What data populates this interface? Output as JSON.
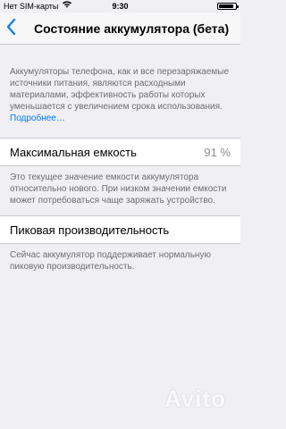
{
  "status_bar": {
    "carrier": "Нет SIM-карты",
    "time": "9:30",
    "wifi_icon": "wifi-icon",
    "battery_icon": "battery-icon",
    "battery_level": 0.9
  },
  "nav": {
    "back_icon": "chevron-left-icon",
    "title": "Состояние аккумулятора (бета)"
  },
  "intro": {
    "text": "Аккумуляторы телефона, как и все перезаряжаемые источники питания, являются расходными материалами, эффективность работы которых уменьшается с увеличением срока использования.",
    "link": "Подробнее…"
  },
  "max_capacity": {
    "label": "Максимальная емкость",
    "value": "91 %",
    "description": "Это текущее значение емкости аккумулятора относительно нового. При низком значении емкости может потребоваться чаще заряжать устройство."
  },
  "peak_performance": {
    "label": "Пиковая производительность",
    "description": "Сейчас аккумулятор поддерживает нормальную пиковую производительность."
  },
  "watermark": "Avito",
  "colors": {
    "accent": "#007aff",
    "background": "#efeff4",
    "secondary_text": "#6d6d72"
  }
}
